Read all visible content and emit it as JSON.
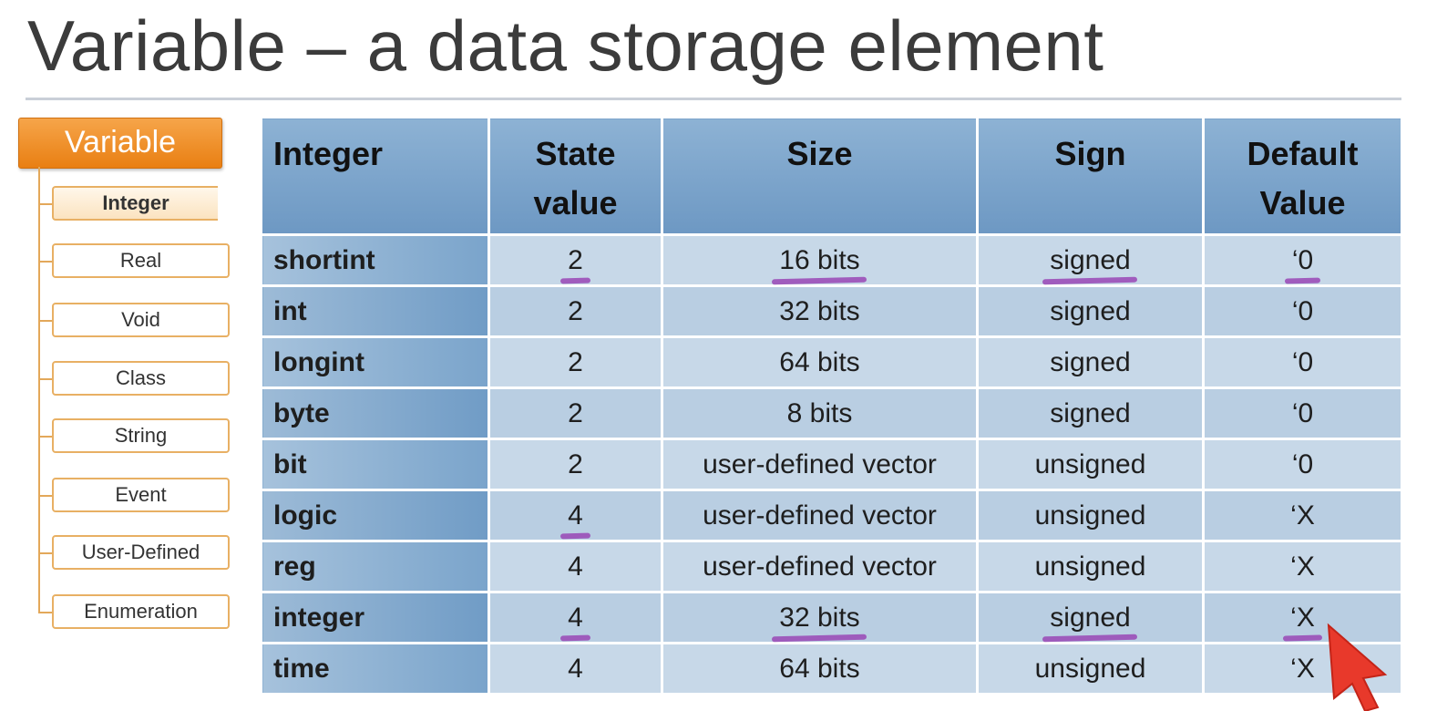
{
  "title": "Variable – a data storage element",
  "hierarchy": {
    "root": "Variable",
    "items": [
      {
        "label": "Integer",
        "active": true
      },
      {
        "label": "Real"
      },
      {
        "label": "Void"
      },
      {
        "label": "Class"
      },
      {
        "label": "String"
      },
      {
        "label": "Event"
      },
      {
        "label": "User-Defined"
      },
      {
        "label": "Enumeration"
      }
    ]
  },
  "table": {
    "headers": [
      "Integer",
      "State value",
      "Size",
      "Sign",
      "Default Value"
    ],
    "rows": [
      [
        "shortint",
        "2",
        "16 bits",
        "signed",
        "‘0"
      ],
      [
        "int",
        "2",
        "32 bits",
        "signed",
        "‘0"
      ],
      [
        "longint",
        "2",
        "64 bits",
        "signed",
        "‘0"
      ],
      [
        "byte",
        "2",
        "8 bits",
        "signed",
        "‘0"
      ],
      [
        "bit",
        "2",
        "user-defined vector",
        "unsigned",
        "‘0"
      ],
      [
        "logic",
        "4",
        "user-defined vector",
        "unsigned",
        "‘X"
      ],
      [
        "reg",
        "4",
        "user-defined vector",
        "unsigned",
        "‘X"
      ],
      [
        "integer",
        "4",
        "32 bits",
        "signed",
        "‘X"
      ],
      [
        "time",
        "4",
        "64 bits",
        "unsigned",
        "‘X"
      ]
    ]
  },
  "colors": {
    "root_fill": "#e97f12",
    "header_fill": "#6d98c3",
    "row_fill": "#c7d8e8",
    "annotation": "#9b4fb8",
    "cursor": "#e8392b"
  }
}
